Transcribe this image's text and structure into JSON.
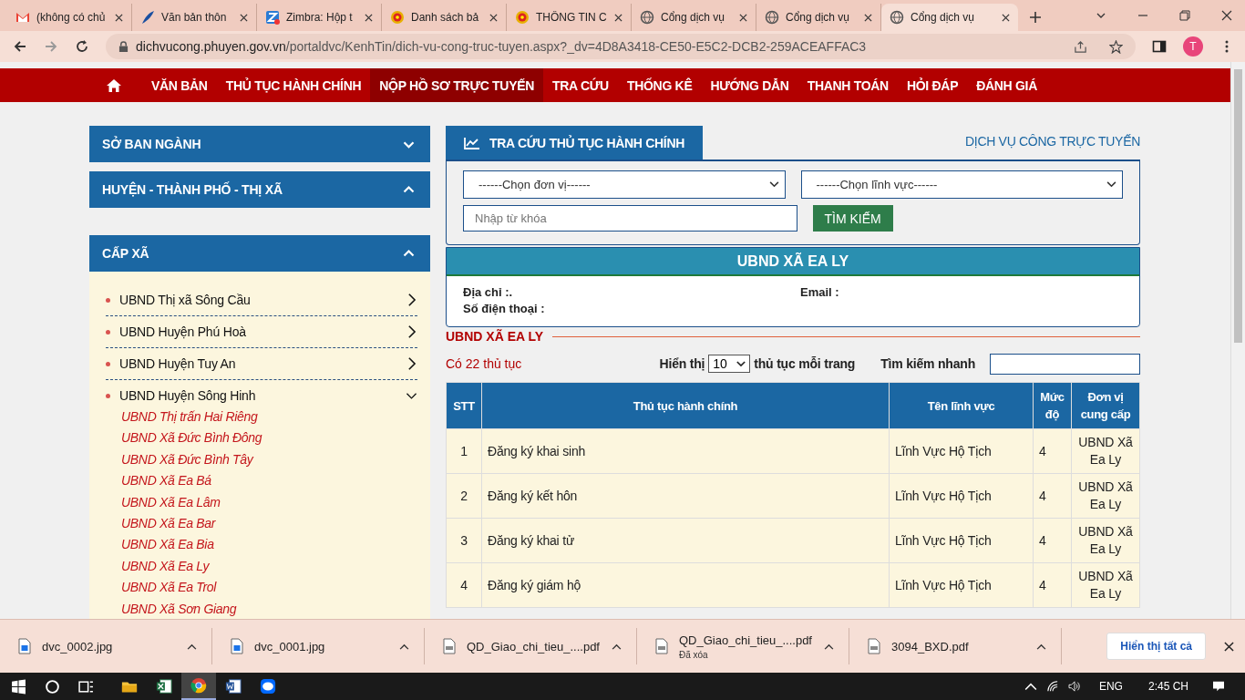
{
  "browser": {
    "tabs": [
      {
        "title": "(không có chủ",
        "kind": "gmail",
        "selected": false
      },
      {
        "title": "Văn bản thôn",
        "kind": "feather",
        "selected": false
      },
      {
        "title": "Zimbra: Hộp t",
        "kind": "zimbra",
        "selected": false
      },
      {
        "title": "Danh sách bả",
        "kind": "emblem",
        "selected": false
      },
      {
        "title": "THÔNG TIN C",
        "kind": "emblem",
        "selected": false
      },
      {
        "title": "Cổng dịch vụ",
        "kind": "globe",
        "selected": false
      },
      {
        "title": "Cổng dịch vụ",
        "kind": "globe",
        "selected": false
      },
      {
        "title": "Cổng dịch vụ",
        "kind": "globe",
        "selected": true
      }
    ],
    "url_host": "dichvucong.phuyen.gov.vn",
    "url_path": "/portaldvc/KenhTin/dich-vu-cong-truc-tuyen.aspx?_dv=4D8A3418-CE50-E5C2-DCB2-259ACEAFFAC3",
    "profile": "T"
  },
  "nav": [
    {
      "label": "VĂN BẢN",
      "selected": false
    },
    {
      "label": "THỦ TỤC HÀNH CHÍNH",
      "selected": false
    },
    {
      "label": "NỘP HỒ SƠ TRỰC TUYẾN",
      "selected": true
    },
    {
      "label": "TRA CỨU",
      "selected": false
    },
    {
      "label": "THỐNG KÊ",
      "selected": false
    },
    {
      "label": "HƯỚNG DẪN",
      "selected": false
    },
    {
      "label": "THANH TOÁN",
      "selected": false
    },
    {
      "label": "HỎI ĐÁP",
      "selected": false
    },
    {
      "label": "ĐÁNH GIÁ",
      "selected": false
    }
  ],
  "sidebar": {
    "sections": [
      {
        "title": "SỞ BAN NGÀNH",
        "expanded": false
      },
      {
        "title": "HUYỆN - THÀNH PHỐ - THỊ XÃ",
        "expanded": true
      },
      {
        "title": "CẤP XÃ",
        "expanded": true,
        "items": [
          {
            "label": "UBND Thị xã Sông Cầu",
            "expanded": false
          },
          {
            "label": "UBND Huyện Phú Hoà",
            "expanded": false
          },
          {
            "label": "UBND Huyện Tuy An",
            "expanded": false
          },
          {
            "label": "UBND Huyện Sông Hinh",
            "expanded": true,
            "children": [
              {
                "label": "UBND Thị trấn Hai Riêng"
              },
              {
                "label": "UBND Xã Đức Bình Đông"
              },
              {
                "label": "UBND Xã Đức Bình Tây"
              },
              {
                "label": "UBND Xã Ea Bá"
              },
              {
                "label": "UBND Xã Ea Lâm"
              },
              {
                "label": "UBND Xã Ea Bar"
              },
              {
                "label": "UBND Xã Ea Bia"
              },
              {
                "label": "UBND Xã Ea Ly"
              },
              {
                "label": "UBND Xã Ea Trol"
              },
              {
                "label": "UBND Xã Sơn Giang"
              }
            ]
          }
        ]
      }
    ]
  },
  "search_panel": {
    "tab": "TRA CỨU THỦ TỤC HÀNH CHÍNH",
    "link": "DỊCH VỤ CÔNG TRỰC TUYẾN",
    "unit_select": "------Chọn đơn vị------",
    "field_select": "------Chọn lĩnh vực------",
    "keyword": {
      "placeholder": "Nhập từ khóa"
    },
    "button": "TÌM KIẾM"
  },
  "unit": {
    "title": "UBND XÃ EA LY",
    "address": "Địa chỉ :.",
    "email": "Email :",
    "phone": "Số điện thoại :"
  },
  "section_title": "UBND XÃ EA LY",
  "count": "Có 22 thủ tục",
  "paging": {
    "show": "Hiển thị",
    "per_page": "10",
    "suffix": "thủ tục mỗi trang",
    "quick_search": "Tìm kiếm nhanh"
  },
  "table": {
    "columns": [
      "STT",
      "Thủ tục hành chính",
      "Tên lĩnh vực",
      "Mức độ",
      "Đơn vị cung cấp"
    ],
    "rows": [
      [
        "1",
        "Đăng ký khai sinh",
        "Lĩnh Vực Hộ Tịch",
        "4",
        "UBND Xã Ea Ly"
      ],
      [
        "2",
        "Đăng ký kết hôn",
        "Lĩnh Vực Hộ Tịch",
        "4",
        "UBND Xã Ea Ly"
      ],
      [
        "3",
        "Đăng ký khai tử",
        "Lĩnh Vực Hộ Tịch",
        "4",
        "UBND Xã Ea Ly"
      ],
      [
        "4",
        "Đăng ký giám hộ",
        "Lĩnh Vực Hộ Tịch",
        "4",
        "UBND Xã Ea Ly"
      ]
    ]
  },
  "downloads": {
    "items": [
      {
        "name": "dvc_0002.jpg",
        "kind": "image"
      },
      {
        "name": "dvc_0001.jpg",
        "kind": "image"
      },
      {
        "name": "QD_Giao_chi_tieu_....pdf",
        "kind": "pdf"
      },
      {
        "name": "QD_Giao_chi_tieu_....pdf",
        "kind": "pdf",
        "note": "Đã xóa"
      },
      {
        "name": "3094_BXD.pdf",
        "kind": "pdf"
      }
    ],
    "show_all": "Hiển thị tất cả"
  },
  "taskbar": {
    "apps": [
      {
        "kind": "folder",
        "selected": false
      },
      {
        "kind": "excel",
        "selected": false
      },
      {
        "kind": "chrome",
        "selected": true
      },
      {
        "kind": "word",
        "selected": false
      },
      {
        "kind": "zalo",
        "selected": false
      }
    ],
    "language": "ENG",
    "time": "2:45 CH"
  }
}
